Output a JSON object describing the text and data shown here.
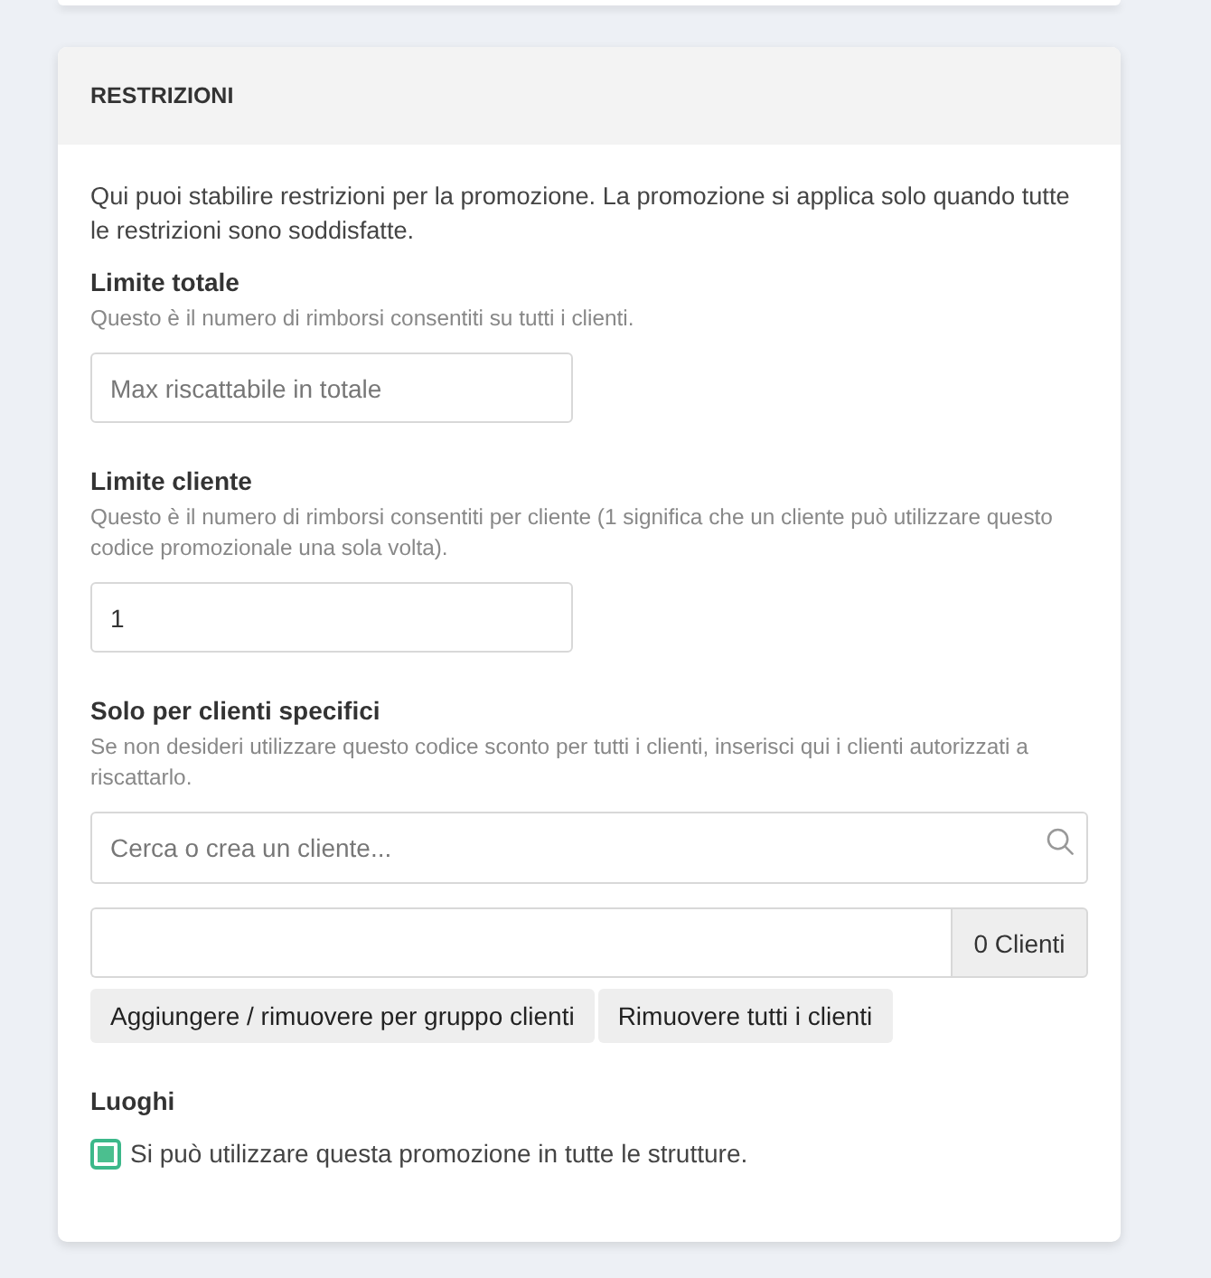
{
  "section": {
    "title": "RESTRIZIONI",
    "intro": "Qui puoi stabilire restrizioni per la promozione. La promozione si applica solo quando tutte le restrizioni sono soddisfatte."
  },
  "fields": [
    {
      "kind": "input",
      "label": "Limite totale",
      "hint": "Questo è il numero di rimborsi consentiti su tutti i clienti.",
      "placeholder": "Max riscattabile in totale"
    },
    {
      "kind": "input",
      "label": "Limite cliente",
      "hint": "Questo è il numero di rimborsi consentiti per cliente (1 significa che un cliente può utilizzare questo codice promozionale una sola volta).",
      "value": "1"
    },
    {
      "kind": "customers",
      "label": "Solo per clienti specifici",
      "hint": "Se non desideri utilizzare questo codice sconto per tutti i clienti, inserisci qui i clienti autorizzati a riscattarlo.",
      "search": {
        "placeholder": "Cerca o crea un cliente..."
      },
      "count": "0 Clienti",
      "buttons": [
        "Aggiungere / rimuovere per gruppo clienti",
        "Rimuovere tutti i clienti"
      ]
    },
    {
      "kind": "checkbox",
      "label": "Luoghi",
      "option": {
        "label": "Si può utilizzare questa promozione in tutte le strutture.",
        "checked": true
      }
    }
  ]
}
